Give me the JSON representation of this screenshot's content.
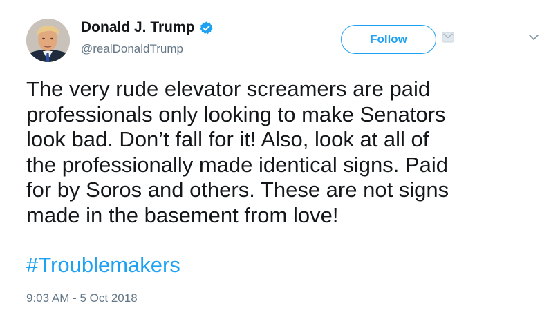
{
  "author": {
    "display_name": "Donald J. Trump",
    "handle": "@realDonaldTrump",
    "verified": true
  },
  "actions": {
    "follow_label": "Follow"
  },
  "tweet": {
    "text": "The very rude elevator screamers are paid\nprofessionals only looking to make Senators\nlook bad. Don’t fall for it! Also, look at all of\nthe professionally made identical signs. Paid\nfor by Soros and others. These are not signs\nmade in the basement from love!",
    "hashtag": "#Troublemakers",
    "timestamp": "9:03 AM - 5 Oct 2018"
  },
  "icons": {
    "verified": "verified-badge-icon",
    "dm": "direct-message-icon",
    "menu": "chevron-down-icon"
  },
  "colors": {
    "accent": "#1da1f2",
    "text": "#14171a",
    "muted": "#657786"
  }
}
